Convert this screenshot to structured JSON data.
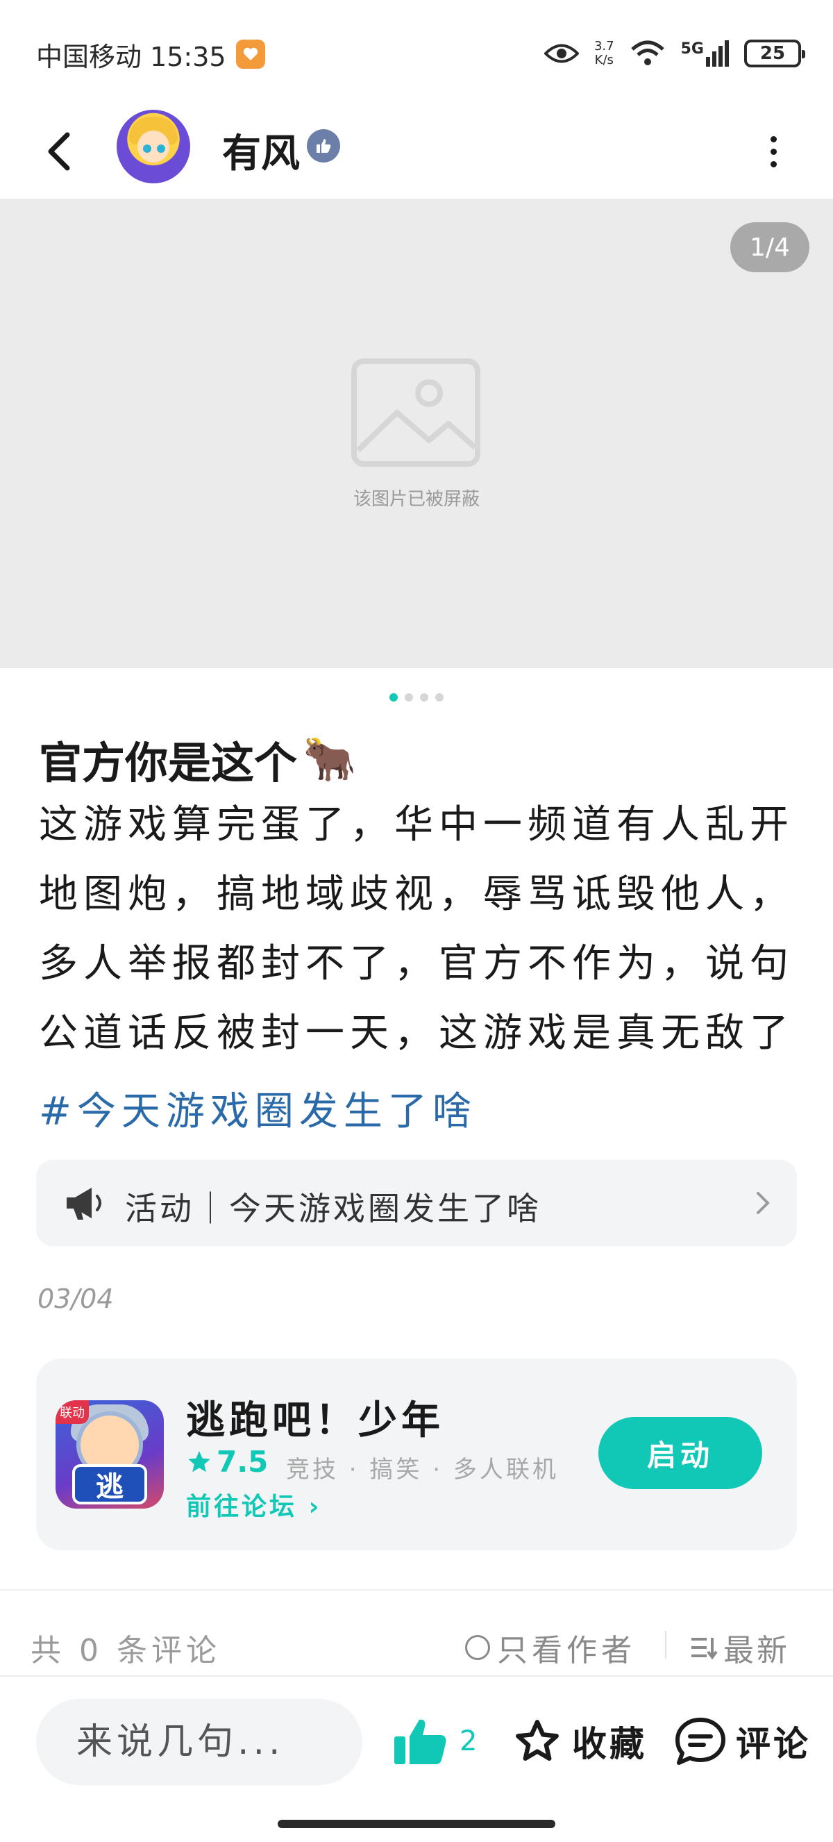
{
  "status_bar": {
    "carrier_time": "中国移动 15:35",
    "net_speed_value": "3.7",
    "net_speed_unit": "K/s",
    "network": "5G",
    "battery": "25"
  },
  "header": {
    "username": "有风"
  },
  "carousel": {
    "page_indicator": "1/4",
    "blocked_text": "该图片已被屏蔽",
    "total_pages": 4,
    "current_page": 1
  },
  "post": {
    "title": "官方你是这个",
    "title_emoji": "🐂",
    "body": "这游戏算完蛋了，华中一频道有人乱开\n地图炮，搞地域歧视，辱骂诋毁他人，\n多人举报都封不了，官方不作为，说句\n公道话反被封一天，这游戏是真无敌了",
    "hashtag": "#今天游戏圈发生了啥",
    "date": "03/04"
  },
  "activity": {
    "label": "活动｜今天游戏圈发生了啥"
  },
  "game": {
    "icon_badge": "联动",
    "icon_char": "逃",
    "name": "逃跑吧！少年",
    "rating": "7.5",
    "tags": "竞技 · 搞笑 · 多人联机",
    "forum_link": "前往论坛",
    "launch_label": "启动"
  },
  "comments": {
    "count_label": "共 0 条评论",
    "author_only_label": "只看作者",
    "sort_label": "最新"
  },
  "bottom_bar": {
    "input_placeholder": "来说几句...",
    "like_count": "2",
    "favorite_label": "收藏",
    "comment_label": "评论"
  },
  "colors": {
    "accent": "#11c7b5",
    "hashtag": "#2a6aa8",
    "card_bg": "#f3f4f6",
    "image_placeholder_bg": "#ebebeb"
  },
  "icons": [
    "back-arrow-icon",
    "verified-thumb-icon",
    "more-vertical-icon",
    "image-blocked-icon",
    "megaphone-icon",
    "chevron-right-icon",
    "star-icon",
    "thumbs-up-icon",
    "star-outline-icon",
    "chat-bubble-icon",
    "sort-list-icon",
    "eye-icon",
    "wifi-icon",
    "signal-icon"
  ]
}
